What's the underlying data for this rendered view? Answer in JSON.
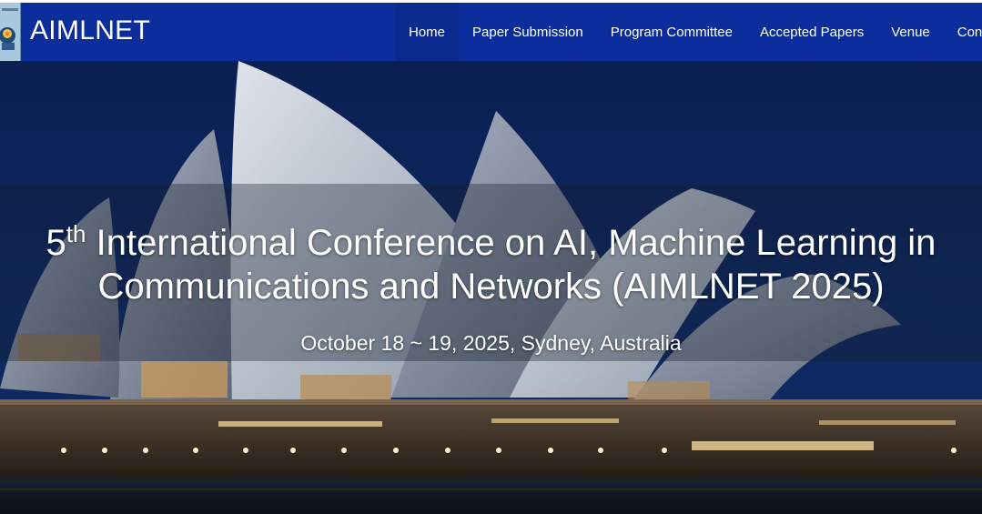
{
  "site": {
    "brand": "AIMLNET",
    "logo_icon": "brain-head-logo-icon"
  },
  "nav": {
    "items": [
      {
        "label": "Home",
        "active": true
      },
      {
        "label": "Paper Submission",
        "active": false
      },
      {
        "label": "Program Committee",
        "active": false
      },
      {
        "label": "Accepted Papers",
        "active": false
      },
      {
        "label": "Venue",
        "active": false
      },
      {
        "label": "Conf",
        "active": false
      }
    ]
  },
  "hero": {
    "ordinal_number": "5",
    "ordinal_suffix": "th",
    "title_line1": " International Conference on AI, Machine Learning in",
    "title_line2": "Communications and Networks (AIMLNET 2025)",
    "subtitle": "October 18 ~ 19, 2025, Sydney, Australia",
    "background_image": "sydney-opera-house-night"
  },
  "colors": {
    "navbar": "#0b2e9c",
    "navbar_active": "#0a2a8f",
    "text": "#ffffff"
  }
}
